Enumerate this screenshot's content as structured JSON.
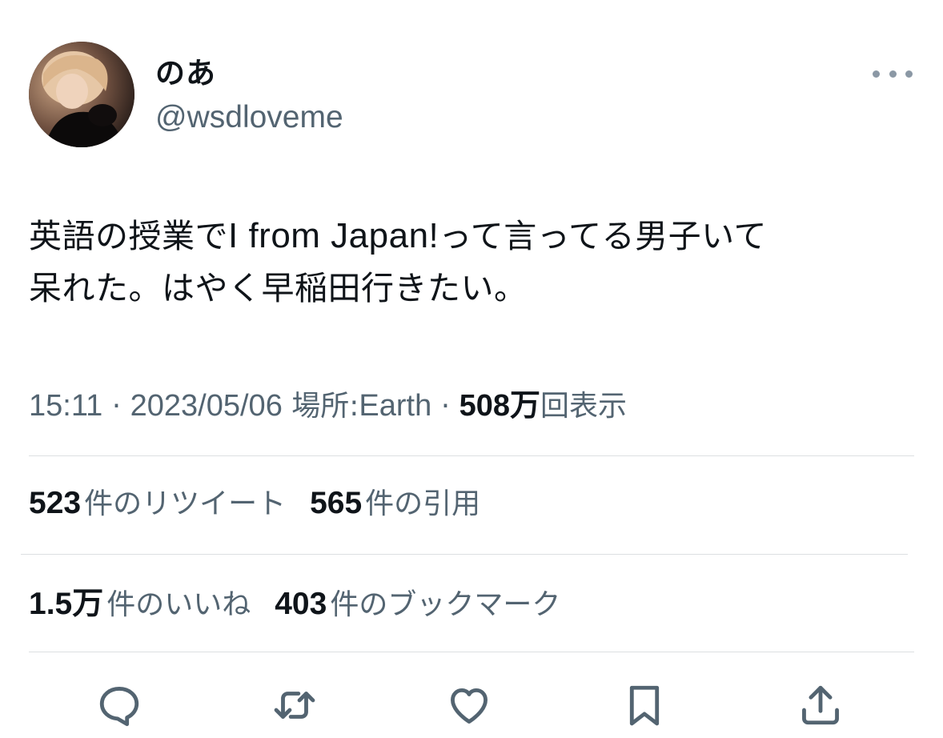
{
  "author": {
    "display_name": "のあ",
    "handle": "@wsdloveme",
    "avatar_icon": "profile-photo"
  },
  "tweet": {
    "text_line1_a": "英語の授業で",
    "text_line1_en": "I from Japan!",
    "text_line1_b": "って言ってる男子いて",
    "text_line2": "呆れた。はやく早稲田行きたい。"
  },
  "meta": {
    "time": "15:11",
    "separator": "·",
    "date": "2023/05/06",
    "location_label": "場所:",
    "location": "Earth",
    "views_count": "508万",
    "views_label": "回表示"
  },
  "stats": {
    "retweets_count": "523",
    "retweets_label": "件のリツイート",
    "quotes_count": "565",
    "quotes_label": "件の引用",
    "likes_count": "1.5万",
    "likes_label": "件のいいね",
    "bookmarks_count": "403",
    "bookmarks_label": "件のブックマーク"
  },
  "actions": [
    "reply-icon",
    "retweet-icon",
    "like-icon",
    "bookmark-icon",
    "share-icon"
  ],
  "colors": {
    "text_primary": "#0f1419",
    "text_secondary": "#536471",
    "divider": "#dcdfe2",
    "icon": "#536471"
  }
}
